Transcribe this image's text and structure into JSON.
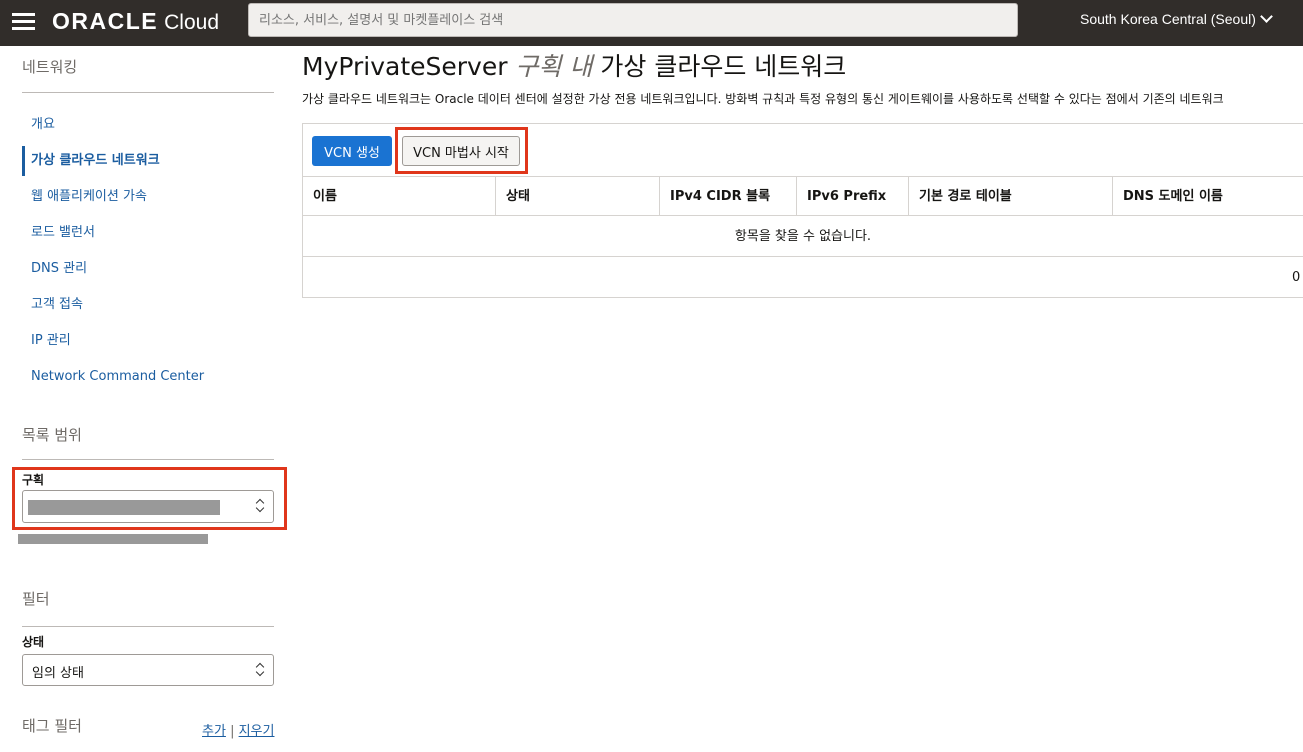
{
  "header": {
    "logo_main": "ORACLE",
    "logo_sub": "Cloud",
    "search_placeholder": "리소스, 서비스, 설명서 및 마켓플레이스 검색",
    "region": "South Korea Central (Seoul)"
  },
  "sidebar": {
    "title": "네트워킹",
    "items": [
      {
        "label": "개요",
        "active": false
      },
      {
        "label": "가상 클라우드 네트워크",
        "active": true
      },
      {
        "label": "웹 애플리케이션 가속",
        "active": false
      },
      {
        "label": "로드 밸런서",
        "active": false
      },
      {
        "label": "DNS 관리",
        "active": false
      },
      {
        "label": "고객 접속",
        "active": false
      },
      {
        "label": "IP 관리",
        "active": false
      },
      {
        "label": "Network Command Center",
        "active": false
      }
    ],
    "scope_heading": "목록 범위",
    "compartment_label": "구획",
    "filters_heading": "필터",
    "state_label": "상태",
    "state_value": "임의 상태",
    "tag_filters_heading": "태그 필터",
    "tag_add": "추가",
    "tag_separator": "|",
    "tag_clear": "지우기"
  },
  "main": {
    "title_server": "MyPrivateServer",
    "title_italic": "구획 내",
    "title_rest": "가상 클라우드 네트워크",
    "description": "가상 클라우드 네트워크는 Oracle 데이터 센터에 설정한 가상 전용 네트워크입니다. 방화벽 규칙과 특정 유형의 통신 게이트웨이를 사용하도록 선택할 수 있다는 점에서 기존의 네트워크",
    "create_button": "VCN 생성",
    "wizard_button": "VCN 마법사 시작",
    "columns": [
      "이름",
      "상태",
      "IPv4 CIDR 블록",
      "IPv6 Prefix",
      "기본 경로 테이블",
      "DNS 도메인 이름"
    ],
    "empty_message": "항목을 찾을 수 없습니다.",
    "footer_text": "0"
  },
  "colors": {
    "topbar": "#312d2a",
    "link": "#1b5da0",
    "primary_button": "#1a73d2",
    "highlight": "#e0361b"
  }
}
